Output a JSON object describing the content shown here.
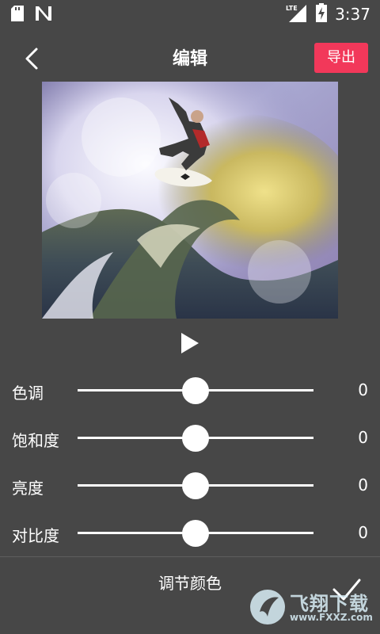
{
  "status_bar": {
    "network_label": "LTE",
    "time": "3:37",
    "icons": [
      "sd-card-icon",
      "n-notification-icon",
      "signal-icon",
      "battery-charging-icon"
    ]
  },
  "header": {
    "title": "编辑",
    "export_label": "导出",
    "back_icon": "chevron-left-icon",
    "accent_color": "#f2385a"
  },
  "preview": {
    "image_description_icon": "surfer-photo",
    "play_icon": "play-icon"
  },
  "adjustments": [
    {
      "label": "色调",
      "value": "0",
      "level": 0.5
    },
    {
      "label": "饱和度",
      "value": "0",
      "level": 0.5
    },
    {
      "label": "亮度",
      "value": "0",
      "level": 0.5
    },
    {
      "label": "对比度",
      "value": "0",
      "level": 0.5
    }
  ],
  "footer": {
    "title": "调节颜色",
    "confirm_icon": "check-icon"
  },
  "watermark": {
    "logo_text": "飞翔下载",
    "url": "www.FXXZ.com"
  }
}
